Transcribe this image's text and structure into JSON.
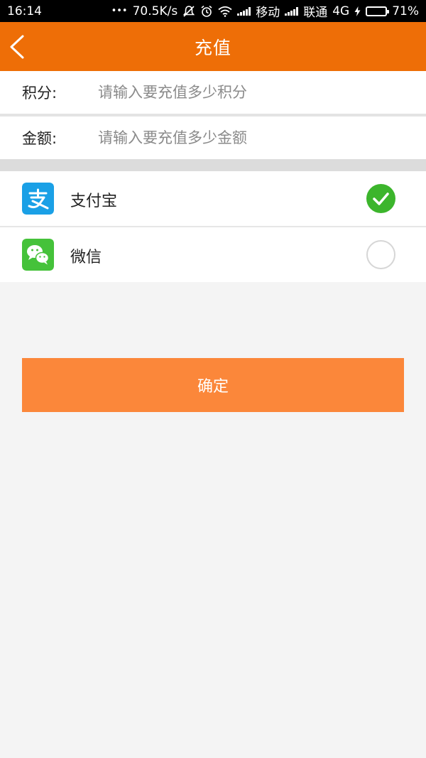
{
  "status_bar": {
    "time": "16:14",
    "dots": "•••",
    "net_speed": "70.5K/s",
    "carrier1": "移动",
    "carrier2": "联通",
    "network_type": "4G",
    "battery": "71%",
    "battery_level": 0.71,
    "colors": {
      "battery_fill": "#34c738"
    }
  },
  "header": {
    "title": "充值",
    "back_icon": "chevron-left-icon",
    "background": "#ee6e07"
  },
  "form": {
    "points": {
      "label": "积分:",
      "placeholder": "请输入要充值多少积分",
      "value": ""
    },
    "amount": {
      "label": "金额:",
      "placeholder": "请输入要充值多少金额",
      "value": ""
    }
  },
  "payment_methods": [
    {
      "label": "支付宝",
      "icon": "alipay-icon",
      "selected": true,
      "color": "#1aa0e6"
    },
    {
      "label": "微信",
      "icon": "wechat-icon",
      "selected": false,
      "color": "#45c23a"
    }
  ],
  "confirm_button": {
    "label": "确定",
    "color": "#fb873a"
  }
}
